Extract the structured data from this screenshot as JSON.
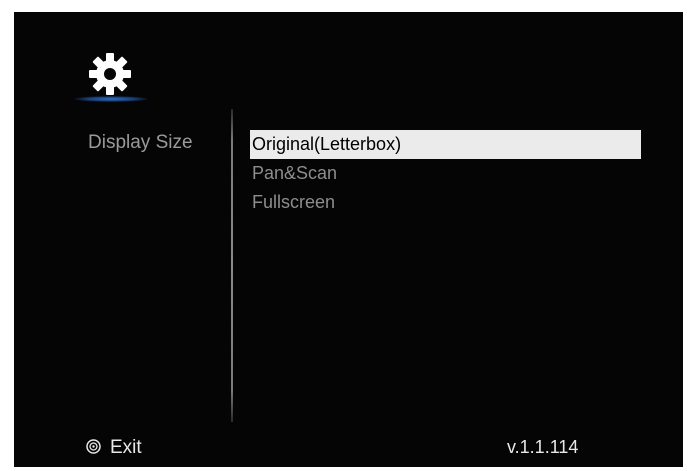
{
  "header": {
    "icon": "gear-icon",
    "accent_color": "#2f6fc0"
  },
  "category": {
    "label": "Display Size"
  },
  "options": {
    "items": [
      {
        "label": "Original(Letterbox)",
        "selected": true
      },
      {
        "label": "Pan&Scan",
        "selected": false
      },
      {
        "label": "Fullscreen",
        "selected": false
      }
    ],
    "selected_bg": "#ebebeb"
  },
  "footer": {
    "exit_icon": "exit-button-icon",
    "exit_label": "Exit",
    "version": "v.1.1.114"
  }
}
